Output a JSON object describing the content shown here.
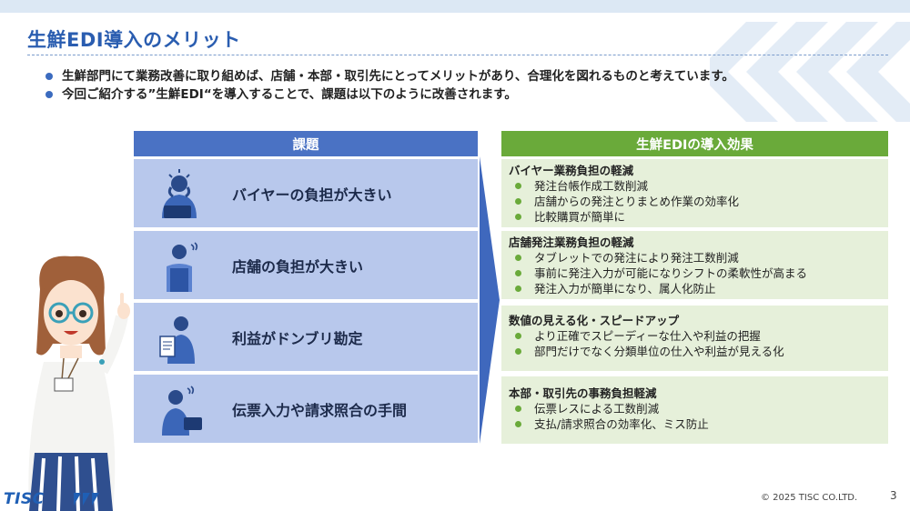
{
  "slide": {
    "title": "生鮮EDI導入のメリット",
    "bullets": [
      "生鮮部門にて業務改善に取り組めば、店舗・本部・取引先にとってメリットがあり、合理化を図れるものと考えています。",
      "今回ご紹介する”生鮮EDI“を導入することで、課題は以下のように改善されます。"
    ],
    "left_header": "課題",
    "right_header": "生鮮EDIの導入効果",
    "issues": [
      {
        "label": "バイヤーの負担が大きい",
        "icon": "stressed-buyer-icon"
      },
      {
        "label": "店舗の負担が大きい",
        "icon": "store-staff-icon"
      },
      {
        "label": "利益がドンブリ勘定",
        "icon": "reading-document-icon"
      },
      {
        "label": "伝票入力や請求照合の手間",
        "icon": "phone-worker-icon"
      }
    ],
    "effects": [
      {
        "heading": "バイヤー業務負担の軽減",
        "items": [
          "発注台帳作成工数削減",
          "店舗からの発注とりまとめ作業の効率化",
          "比較購買が簡単に"
        ]
      },
      {
        "heading": "店舗発注業務負担の軽減",
        "items": [
          "タブレットでの発注により発注工数削減",
          "事前に発注入力が可能になりシフトの柔軟性が高まる",
          "発注入力が簡単になり、属人化防止"
        ]
      },
      {
        "heading": "数値の見える化・スピードアップ",
        "items": [
          "より正確でスピーディーな仕入や利益の把握",
          "部門だけでなく分類単位の仕入や利益が見える化"
        ]
      },
      {
        "heading": "本部・取引先の事務負担軽減",
        "items": [
          "伝票レスによる工数削減",
          "支払/請求照合の効率化、ミス防止"
        ]
      }
    ],
    "logo_text": "TISC",
    "copyright": "© 2025 TISC CO.LTD.",
    "page_number": "3"
  },
  "colors": {
    "title": "#2a5db0",
    "left_header": "#4a72c4",
    "right_header": "#6aaa3a",
    "issue_bg": "#b8c8ec",
    "effect_bg": "#e6f0da"
  }
}
